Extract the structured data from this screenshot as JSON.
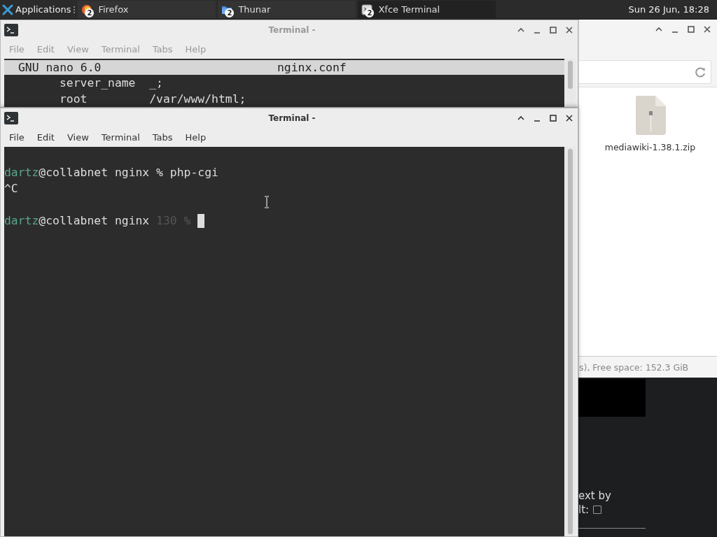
{
  "panel": {
    "applications_menu": {
      "label": "Applications"
    },
    "tasks": [
      {
        "label": "Firefox",
        "count": "2",
        "kind": "browser",
        "selected": false
      },
      {
        "label": "Thunar",
        "count": "2",
        "kind": "folder",
        "selected": false
      },
      {
        "label": "Xfce Terminal",
        "count": "2",
        "kind": "terminal",
        "selected": true
      }
    ],
    "clock": "Sun 26 Jun, 18:28"
  },
  "file_manager": {
    "file": {
      "name": "mediawiki-1.38.1.zip"
    },
    "status_bar": "s), Free space: 152.3 GiB"
  },
  "background_window": {
    "lines": [
      "ext by",
      "lt:"
    ],
    "checkbox": {
      "checked": false
    }
  },
  "terminals": [
    {
      "title": "Terminal -",
      "active": false,
      "menu": [
        "File",
        "Edit",
        "View",
        "Terminal",
        "Tabs",
        "Help"
      ],
      "nano_header": {
        "version": "GNU nano 6.0",
        "file": "nginx.conf"
      },
      "lines": [
        {
          "kind": "text",
          "segments": [
            {
              "text": "        server_name  _;",
              "kind": "plain"
            }
          ]
        },
        {
          "kind": "text",
          "segments": [
            {
              "text": "        root         /var/www/html;",
              "kind": "plain"
            }
          ]
        }
      ]
    },
    {
      "title": "Terminal -",
      "active": true,
      "menu": [
        "File",
        "Edit",
        "View",
        "Terminal",
        "Tabs",
        "Help"
      ],
      "lines": [
        {
          "kind": "text",
          "segments": [
            {
              "text": "dartz",
              "kind": "user"
            },
            {
              "text": "@collabnet nginx % php-cgi",
              "kind": "plain"
            }
          ]
        },
        {
          "kind": "text",
          "segments": [
            {
              "text": "^C",
              "kind": "plain"
            }
          ]
        },
        {
          "kind": "blank"
        },
        {
          "kind": "text",
          "segments": [
            {
              "text": "dartz",
              "kind": "user"
            },
            {
              "text": "@collabnet nginx ",
              "kind": "plain"
            },
            {
              "text": "130 %",
              "kind": "dim"
            }
          ],
          "cursor": true
        }
      ]
    }
  ]
}
